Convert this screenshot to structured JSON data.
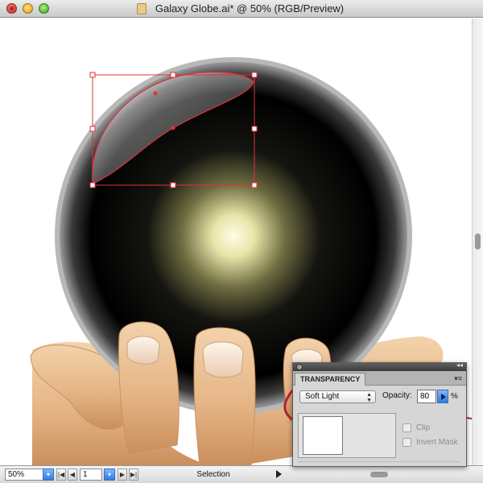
{
  "window": {
    "title": "Galaxy Globe.ai* @ 50% (RGB/Preview)"
  },
  "icons": {
    "close": "close-button",
    "minimize": "minimize-button",
    "zoom": "zoom-button",
    "document": "illustrator-document-icon"
  },
  "status_bar": {
    "zoom_value": "50%",
    "page_value": "1",
    "tool_name": "Selection"
  },
  "transparency_panel": {
    "tab_label": "TRANSPARENCY",
    "blend_mode": "Soft Light",
    "opacity_label": "Opacity:",
    "opacity_value": "80",
    "opacity_unit": "%",
    "clip_label": "Clip",
    "invert_mask_label": "Invert Mask"
  },
  "colors": {
    "selection": "#e0303a",
    "annotation_ring": "#b02533",
    "accent_blue": "#2f7be6"
  }
}
